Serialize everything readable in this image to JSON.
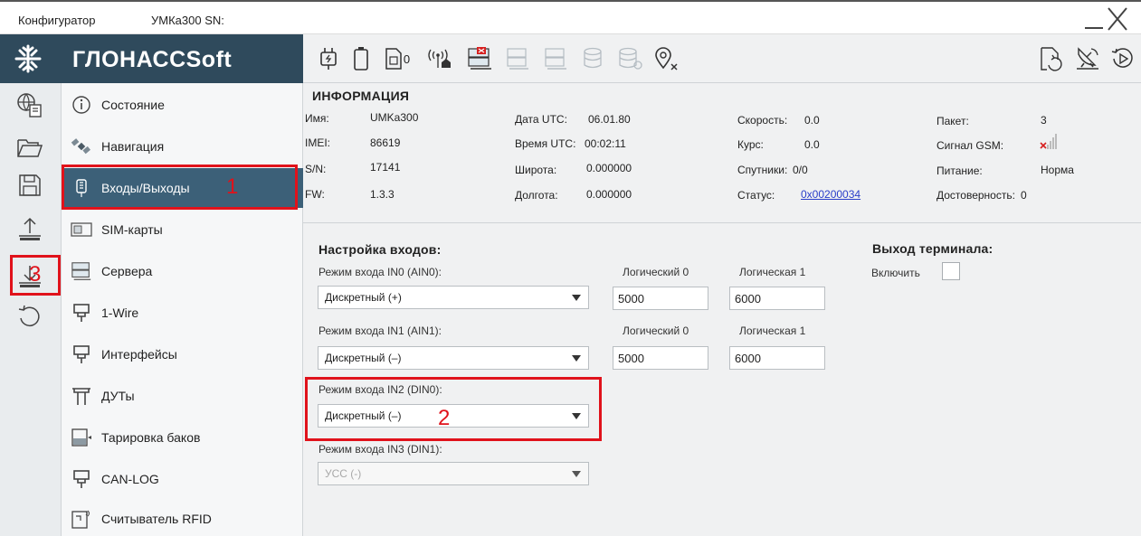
{
  "window": {
    "app_name": "Конфигуратор",
    "device_title": "УМКа300 SN:"
  },
  "brand": {
    "logo_text": "ГЛОНАССSoft"
  },
  "toolbar": {
    "icons": [
      "power-plug-icon",
      "battery-icon",
      "sim-slot-icon",
      "antenna-home-icon",
      "server-connected-icon",
      "server-icon",
      "server-icon",
      "database-icon",
      "database-settings-icon",
      "location-off-icon",
      "file-refresh-icon",
      "satellite-dish-icon",
      "playback-icon"
    ],
    "sim_slot_value": "0"
  },
  "rail": {
    "icons": [
      "globe-device-icon",
      "open-folder-icon",
      "save-icon",
      "upload-icon",
      "download-icon",
      "reset-icon"
    ]
  },
  "nav": {
    "items": [
      {
        "label": "Состояние",
        "icon": "info-icon"
      },
      {
        "label": "Навигация",
        "icon": "satellite-icon"
      },
      {
        "label": "Входы/Выходы",
        "icon": "io-plug-icon"
      },
      {
        "label": "SIM-карты",
        "icon": "sim-card-icon"
      },
      {
        "label": "Сервера",
        "icon": "server-rack-icon"
      },
      {
        "label": "1-Wire",
        "icon": "connector-icon"
      },
      {
        "label": "Интерфейсы",
        "icon": "connector-icon"
      },
      {
        "label": "ДУТы",
        "icon": "fuel-sensor-icon"
      },
      {
        "label": "Тарировка баков",
        "icon": "tank-icon"
      },
      {
        "label": "CAN-LOG",
        "icon": "connector-icon"
      },
      {
        "label": "Считыватель RFID",
        "icon": "rfid-reader-icon"
      }
    ],
    "active_index": 2
  },
  "annotations": {
    "n1": "1",
    "n2": "2",
    "n3": "3"
  },
  "info": {
    "title": "ИНФОРМАЦИЯ",
    "name_label": "Имя:",
    "name_value": "UMKa300",
    "imei_label": "IMEI:",
    "imei_value": "86619",
    "sn_label": "S/N:",
    "sn_value": "17141",
    "fw_label": "FW:",
    "fw_value": "1.3.3",
    "date_label": "Дата UTC:",
    "date_value": "06.01.80",
    "time_label": "Время UTC:",
    "time_value": "00:02:11",
    "lat_label": "Широта:",
    "lat_value": "0.000000",
    "lon_label": "Долгота:",
    "lon_value": "0.000000",
    "speed_label": "Скорость:",
    "speed_value": "0.0",
    "course_label": "Курс:",
    "course_value": "0.0",
    "sats_label": "Спутники:",
    "sats_value": "0/0",
    "status_label": "Статус:",
    "status_value": "0x00200034",
    "packet_label": "Пакет:",
    "packet_value": "3",
    "gsm_label": "Сигнал GSM:",
    "power_label": "Питание:",
    "power_value": "Норма",
    "valid_label": "Достоверность:",
    "valid_value": "0"
  },
  "inputs": {
    "title": "Настройка входов:",
    "logic0_label": "Логический 0",
    "logic1_label": "Логическая 1",
    "in0": {
      "label": "Режим входа IN0 (AIN0):",
      "value": "Дискретный (+)",
      "logic0": "5000",
      "logic1": "6000"
    },
    "in1": {
      "label": "Режим входа IN1 (AIN1):",
      "value": "Дискретный (–)",
      "logic0": "5000",
      "logic1": "6000"
    },
    "in2": {
      "label": "Режим входа IN2 (DIN0):",
      "value": "Дискретный (–)"
    },
    "in3": {
      "label": "Режим входа IN3 (DIN1):",
      "value": "УСС (-)"
    }
  },
  "output": {
    "title": "Выход терминала:",
    "enable_label": "Включить"
  }
}
